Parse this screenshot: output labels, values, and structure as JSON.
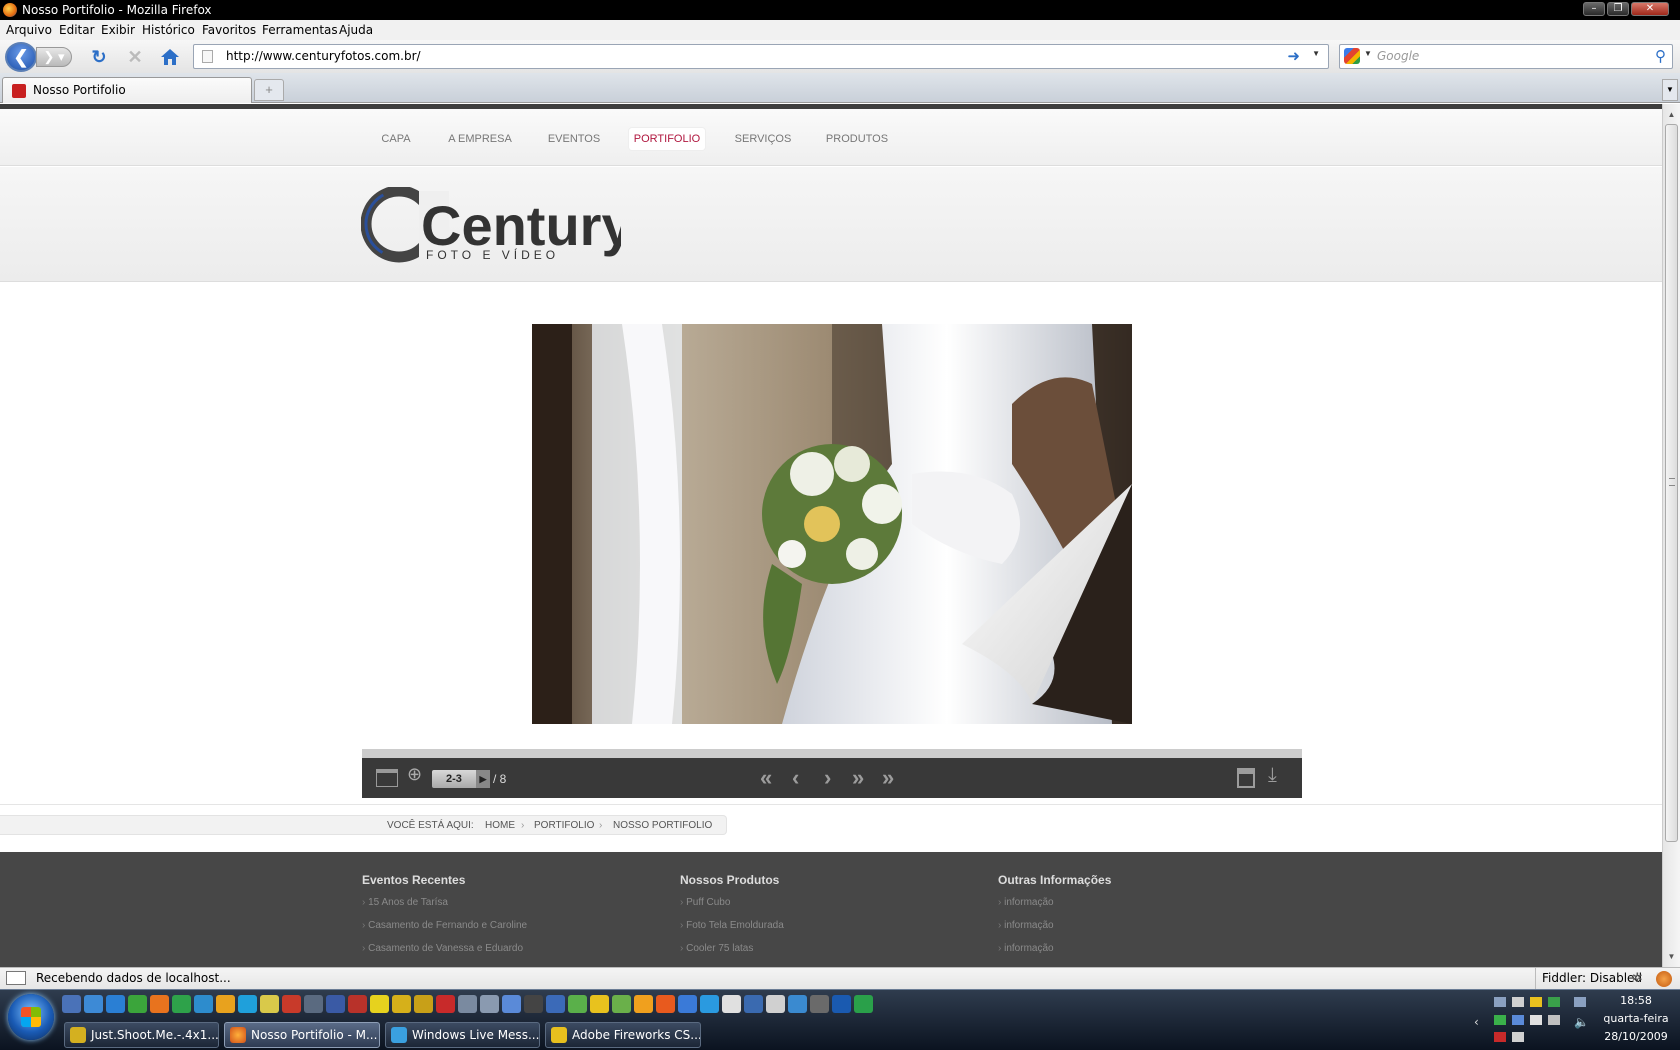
{
  "window": {
    "title": "Nosso Portifolio - Mozilla Firefox"
  },
  "menu": [
    "Arquivo",
    "Editar",
    "Exibir",
    "Histórico",
    "Favoritos",
    "Ferramentas",
    "Ajuda"
  ],
  "address": {
    "url": "http://www.centuryfotos.com.br/",
    "search_placeholder": "Google"
  },
  "tab": {
    "title": "Nosso Portifolio",
    "new_tab": "+"
  },
  "site": {
    "nav": [
      {
        "label": "CAPA",
        "active": false
      },
      {
        "label": "A EMPRESA",
        "active": false
      },
      {
        "label": "EVENTOS",
        "active": false
      },
      {
        "label": "PORTIFOLIO",
        "active": true
      },
      {
        "label": "SERVIÇOS",
        "active": false
      },
      {
        "label": "PRODUTOS",
        "active": false
      }
    ],
    "logo": {
      "main": "Century",
      "sub": "FOTO E VÍDEO"
    },
    "viewer": {
      "page": "2-3",
      "total": "/ 8"
    },
    "breadcrumb": {
      "prefix": "VOCÊ ESTÁ AQUI:",
      "items": [
        "HOME",
        "PORTIFOLIO",
        "NOSSO PORTIFOLIO"
      ]
    },
    "footer": [
      {
        "heading": "Eventos Recentes",
        "items": [
          "15 Anos de Tarísa",
          "Casamento de Fernando e Caroline",
          "Casamento de Vanessa e Eduardo"
        ]
      },
      {
        "heading": "Nossos Produtos",
        "items": [
          "Puff Cubo",
          "Foto Tela Emoldurada",
          "Cooler 75 latas"
        ]
      },
      {
        "heading": "Outras Informações",
        "items": [
          "informação",
          "informação",
          "informação"
        ]
      }
    ],
    "colors": {
      "accent": "#b0173f",
      "footer_bg": "#474747",
      "toolbar_bg": "#393939"
    }
  },
  "status": {
    "text": "Recebendo dados de localhost...",
    "fiddler": "Fiddler: Disabled"
  },
  "taskbar": {
    "tasks": [
      {
        "label": "Just.Shoot.Me.-.4x1...",
        "active": false
      },
      {
        "label": "Nosso Portifolio - M...",
        "active": true
      },
      {
        "label": "Windows Live Mess...",
        "active": false
      },
      {
        "label": "Adobe Fireworks CS...",
        "active": false
      }
    ],
    "clock": {
      "time": "18:58",
      "day": "quarta-feira",
      "date": "28/10/2009"
    }
  }
}
